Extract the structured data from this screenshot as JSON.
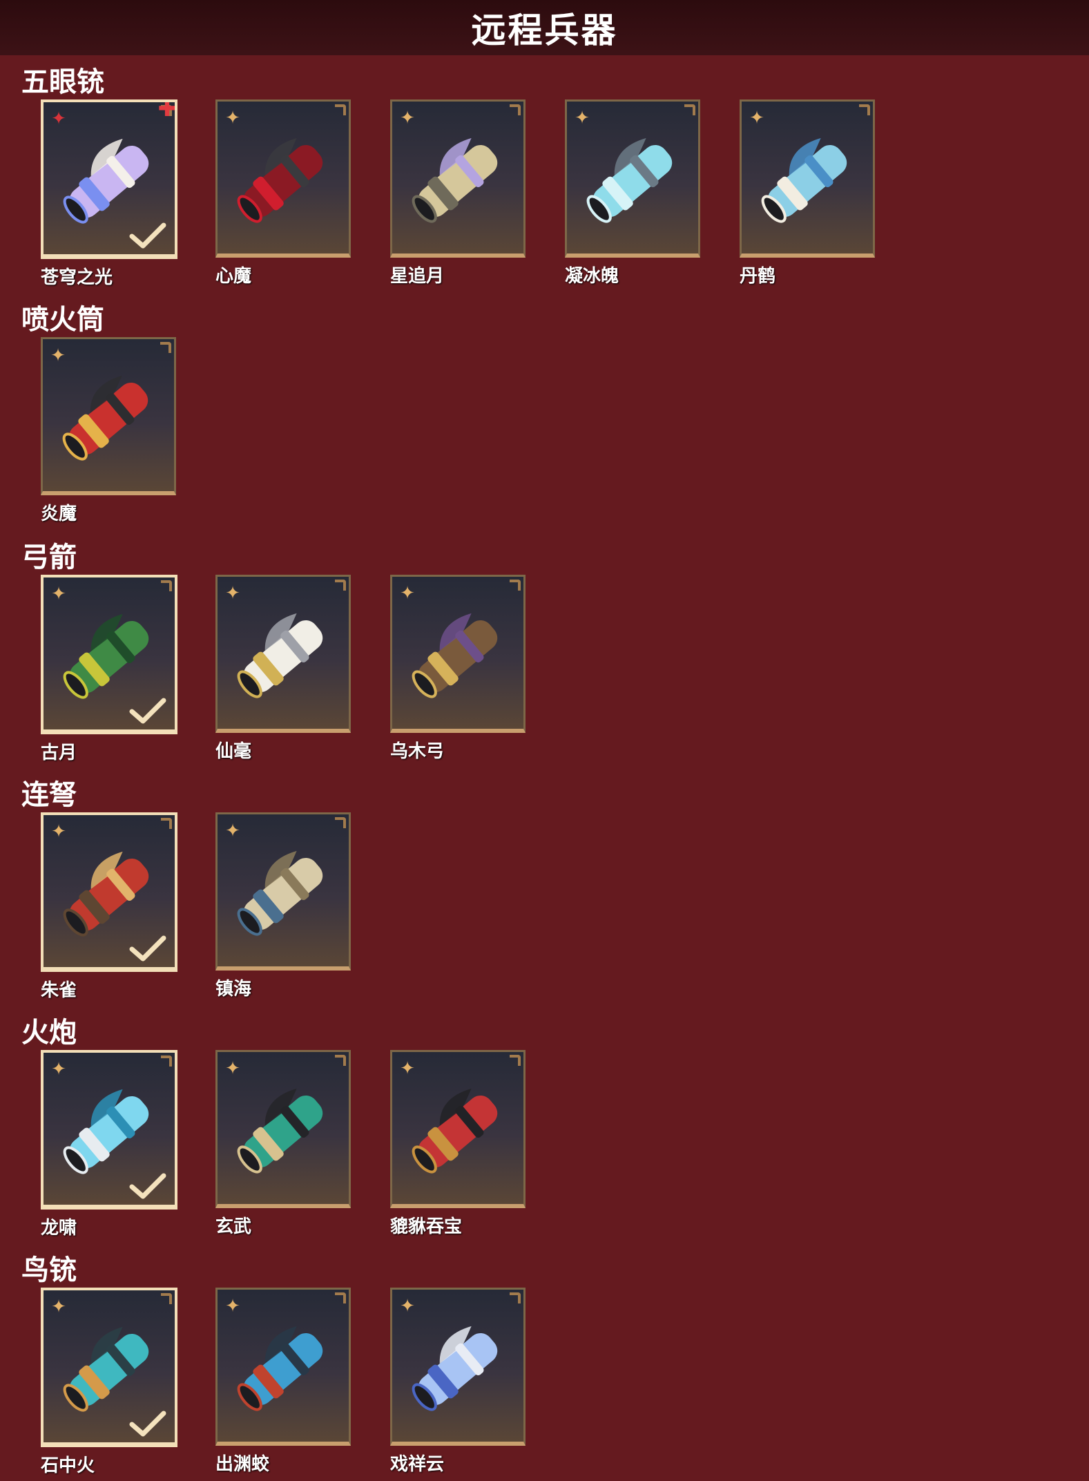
{
  "header": {
    "title": "远程兵器"
  },
  "sections": [
    {
      "title": "五眼铳",
      "items": [
        {
          "name": "苍穹之光",
          "selected": true,
          "star": "red",
          "plus": true,
          "palette": [
            "#c9b6f2",
            "#7a8ff0",
            "#f4f0ea"
          ]
        },
        {
          "name": "心魔",
          "palette": [
            "#8b1a24",
            "#d01e2e",
            "#3a3a3e"
          ]
        },
        {
          "name": "星追月",
          "palette": [
            "#d5c79b",
            "#6f6a5a",
            "#b4a4e0"
          ]
        },
        {
          "name": "凝冰魄",
          "palette": [
            "#8fdcea",
            "#d7f3f7",
            "#6b7a86"
          ]
        },
        {
          "name": "丹鹤",
          "palette": [
            "#8ccfe6",
            "#f2ede1",
            "#4a8fc7"
          ]
        }
      ]
    },
    {
      "title": "喷火筒",
      "items": [
        {
          "name": "炎魔",
          "palette": [
            "#c9312e",
            "#e5b24a",
            "#2d2d30"
          ]
        }
      ]
    },
    {
      "title": "弓箭",
      "items": [
        {
          "name": "古月",
          "selected": true,
          "palette": [
            "#3f8a45",
            "#c8c63a",
            "#1f4d2a"
          ]
        },
        {
          "name": "仙毫",
          "palette": [
            "#f1eee6",
            "#d1b155",
            "#9ea0a8"
          ]
        },
        {
          "name": "乌木弓",
          "palette": [
            "#7a5a3c",
            "#d6b25a",
            "#6d4f8a"
          ]
        }
      ]
    },
    {
      "title": "连弩",
      "items": [
        {
          "name": "朱雀",
          "selected": true,
          "palette": [
            "#c13a2e",
            "#5e4632",
            "#e2b46b"
          ]
        },
        {
          "name": "镇海",
          "palette": [
            "#d8cba8",
            "#4a6f8f",
            "#8a7a5a"
          ]
        }
      ]
    },
    {
      "title": "火炮",
      "items": [
        {
          "name": "龙啸",
          "selected": true,
          "palette": [
            "#7fd7ef",
            "#e7ecf0",
            "#2c8fb5"
          ]
        },
        {
          "name": "玄武",
          "palette": [
            "#2fa38a",
            "#d7c28f",
            "#242428"
          ]
        },
        {
          "name": "貔貅吞宝",
          "palette": [
            "#c43435",
            "#c9923f",
            "#222226"
          ]
        }
      ]
    },
    {
      "title": "鸟铳",
      "items": [
        {
          "name": "石中火",
          "selected": true,
          "palette": [
            "#3fb8c0",
            "#d49a4a",
            "#2a3f46"
          ]
        },
        {
          "name": "出渊蛟",
          "palette": [
            "#3e9ed0",
            "#c0432e",
            "#283848"
          ]
        },
        {
          "name": "戏祥云",
          "palette": [
            "#a8c4f4",
            "#4a66c4",
            "#e8ecf4"
          ]
        }
      ]
    }
  ]
}
